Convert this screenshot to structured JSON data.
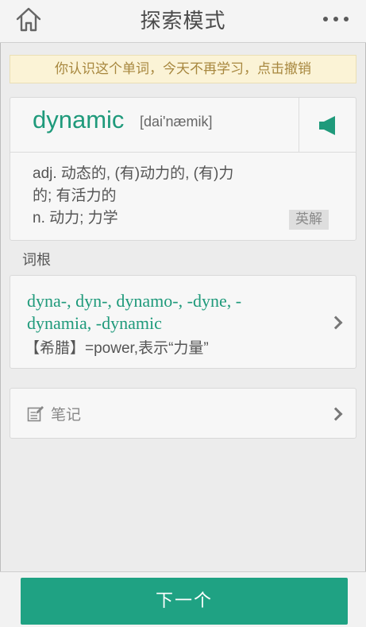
{
  "header": {
    "title": "探索模式",
    "home_icon": "home-icon",
    "more_icon": "more-dots-icon"
  },
  "notice": {
    "text": "你认识这个单词，今天不再学习，点击撤销"
  },
  "word": {
    "term": "dynamic",
    "phonetic": "[dai'næmik]",
    "speaker_icon": "speaker-icon",
    "definitions": [
      "adj. 动态的, (有)动力的, (有)力",
      "的; 有活力的",
      "n. 动力; 力学"
    ],
    "en_button": "英解"
  },
  "root_section": {
    "label": "词根",
    "root_lines": [
      "dyna-, dyn-, dynamo-, -dyne, -",
      "dynamia, -dynamic"
    ],
    "description": "【希腊】=power,表示“力量”"
  },
  "notes": {
    "label": "笔记",
    "icon": "edit-note-icon"
  },
  "footer": {
    "next_label": "下一个"
  },
  "colors": {
    "accent": "#1fa283",
    "notice_bg": "#fbf3d6",
    "notice_text": "#a7873e"
  }
}
